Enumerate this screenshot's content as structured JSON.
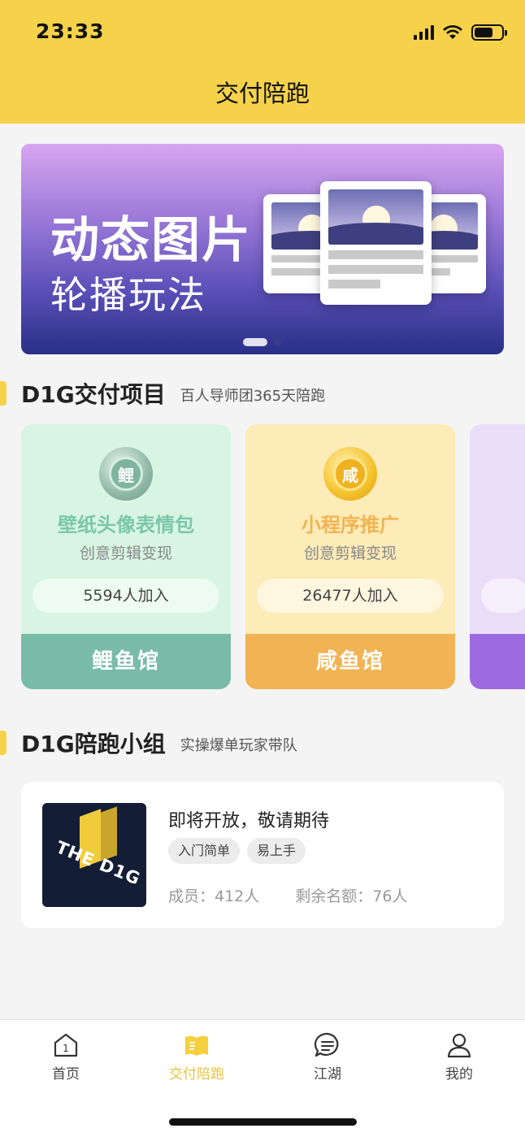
{
  "status_bar": {
    "time": "23:33"
  },
  "header": {
    "title": "交付陪跑"
  },
  "banner": {
    "title": "动态图片",
    "subtitle": "轮播玩法",
    "slide_count": 2,
    "active_slide": 1
  },
  "projects_section": {
    "title": "D1G交付项目",
    "subtitle": "百人导师团365天陪跑",
    "cards": [
      {
        "coin_char": "鲤",
        "name": "壁纸头像表情包",
        "desc": "创意剪辑变现",
        "join_text": "5594人加入",
        "footer": "鲤鱼馆",
        "accent": "#7cc7a9",
        "bg": "#d8f5e3",
        "footer_bg": "#78bba6"
      },
      {
        "coin_char": "咸",
        "name": "小程序推广",
        "desc": "创意剪辑变现",
        "join_text": "26477人加入",
        "footer": "咸鱼馆",
        "accent": "#f1b451",
        "bg": "#fdebb8",
        "footer_bg": "#f2b354"
      },
      {
        "coin_char": "",
        "name": "",
        "desc": "",
        "join_text": "",
        "footer": "",
        "accent": "#9b6ce0",
        "bg": "#e9def8",
        "footer_bg": "#9c6ae0"
      }
    ]
  },
  "groups_section": {
    "title": "D1G陪跑小组",
    "subtitle": "实操爆单玩家带队",
    "group": {
      "thumb_text": "THE D1G",
      "title": "即将开放，敬请期待",
      "tags": [
        "入门简单",
        "易上手"
      ],
      "members": "成员：412人",
      "remaining": "剩余名额：76人"
    }
  },
  "bottom_nav": {
    "items": [
      {
        "label": "首页",
        "icon": "home-icon",
        "badge": "1"
      },
      {
        "label": "交付陪跑",
        "icon": "book-icon",
        "active": true
      },
      {
        "label": "江湖",
        "icon": "chat-icon"
      },
      {
        "label": "我的",
        "icon": "profile-icon"
      }
    ]
  },
  "colors": {
    "brand_yellow": "#f6d24a",
    "active_nav": "#e9c23d"
  }
}
